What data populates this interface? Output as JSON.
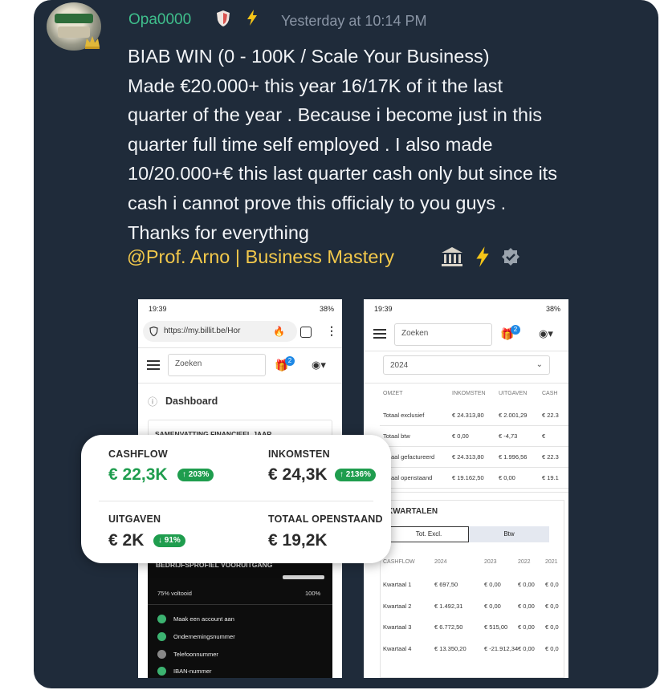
{
  "message": {
    "username": "Opa0000",
    "timestamp": "Yesterday at 10:14 PM",
    "lines": [
      "BIAB WIN (0 - 100K / Scale Your Business)",
      "Made €20.000+ this year 16/17K of it the last",
      "quarter of the year . Because i become just in this",
      "quarter full time self employed . I also made",
      "10/20.000+€ this last quarter cash only but since its",
      "cash i cannot prove this officialy to you guys .",
      "Thanks for everything"
    ],
    "mention": "@Prof. Arno | Business Mastery",
    "colors": {
      "background": "#1f2b3a",
      "username": "#3fbf8c",
      "mention": "#f2c84b",
      "text": "#f2f4f7",
      "timestamp": "#8a95a5"
    }
  },
  "phone1": {
    "time": "19:39",
    "battery": "38%",
    "url": "https://my.billit.be/Hor",
    "search_placeholder": "Zoeken",
    "gift_badge": "2",
    "dashboard_title": "Dashboard",
    "summary_heading": "SAMENVATTING FINANCIEEL JAAR",
    "profile_heading": "BEDRIJFSPROFIEL VOORUITGANG",
    "progress_text": "75% voltooid",
    "progress_max": "100%",
    "progress_value": 0.75,
    "checklist": [
      {
        "label": "Maak een account aan",
        "done": true
      },
      {
        "label": "Ondernemingsnummer",
        "done": true
      },
      {
        "label": "Telefoonnummer",
        "done": false
      },
      {
        "label": "IBAN-nummer",
        "done": true
      }
    ]
  },
  "phone2": {
    "time": "19:39",
    "battery": "38%",
    "search_placeholder": "Zoeken",
    "gift_badge": "2",
    "year_select": "2024",
    "table_headers": [
      "OMZET",
      "INKOMSTEN",
      "UITGAVEN",
      "CASH"
    ],
    "table_rows": [
      [
        "Totaal exclusief",
        "€ 24.313,80",
        "€ 2.001,29",
        "€ 22.3"
      ],
      [
        "Totaal btw",
        "€ 0,00",
        "€ -4,73",
        "€"
      ],
      [
        "Totaal gefactureerd",
        "€ 24.313,80",
        "€ 1.996,56",
        "€ 22.3"
      ],
      [
        "Totaal openstaand",
        "€ 19.162,50",
        "€ 0,00",
        "€ 19.1"
      ]
    ],
    "kwartalen_title": "KWARTALEN",
    "tab_active": "Tot. Excl.",
    "tab_inactive": "Btw",
    "q_headers": [
      "CASHFLOW",
      "2024",
      "2023",
      "2022",
      "2021"
    ],
    "q_rows": [
      [
        "Kwartaal 1",
        "€ 697,50",
        "€ 0,00",
        "€ 0,00",
        "€ 0,0"
      ],
      [
        "Kwartaal 2",
        "€ 1.492,31",
        "€ 0,00",
        "€ 0,00",
        "€ 0,0"
      ],
      [
        "Kwartaal 3",
        "€ 6.772,50",
        "€ 515,00",
        "€ 0,00",
        "€ 0,0"
      ],
      [
        "Kwartaal 4",
        "€ 13.350,20",
        "€ -21.912,34",
        "€ 0,00",
        "€ 0,0"
      ]
    ]
  },
  "stats": {
    "cashflow": {
      "label": "CASHFLOW",
      "value": "€ 22,3K",
      "change": "↑ 203%"
    },
    "inkomsten": {
      "label": "INKOMSTEN",
      "value": "€ 24,3K",
      "change": "↑ 2136%"
    },
    "uitgaven": {
      "label": "UITGAVEN",
      "value": "€ 2K",
      "change": "↓ 91%"
    },
    "openstaand": {
      "label": "TOTAAL OPENSTAAND",
      "value": "€ 19,2K"
    },
    "colors": {
      "positive": "#1f9d4e",
      "neutral": "#2b2b2b"
    }
  }
}
